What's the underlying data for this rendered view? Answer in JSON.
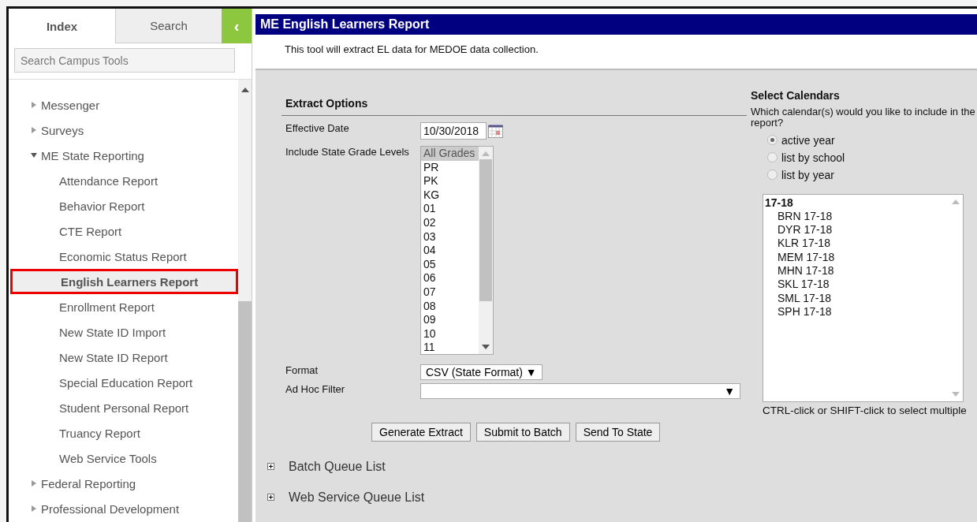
{
  "sidebar": {
    "tabs": [
      {
        "label": "Index",
        "selected": true
      },
      {
        "label": "Search",
        "selected": false
      }
    ],
    "collapse_button": "‹",
    "search": {
      "placeholder": "Search Campus Tools"
    },
    "tree": [
      {
        "label": "Messenger",
        "expanded": false
      },
      {
        "label": "Surveys",
        "expanded": false
      },
      {
        "label": "ME State Reporting",
        "expanded": true,
        "children": [
          {
            "label": "Attendance Report",
            "selected": false
          },
          {
            "label": "Behavior Report",
            "selected": false
          },
          {
            "label": "CTE Report",
            "selected": false
          },
          {
            "label": "Economic Status Report",
            "selected": false
          },
          {
            "label": "English Learners Report",
            "selected": true
          },
          {
            "label": "Enrollment Report",
            "selected": false
          },
          {
            "label": "New State ID Import",
            "selected": false
          },
          {
            "label": "New State ID Report",
            "selected": false
          },
          {
            "label": "Special Education Report",
            "selected": false
          },
          {
            "label": "Student Personal Report",
            "selected": false
          },
          {
            "label": "Truancy Report",
            "selected": false
          },
          {
            "label": "Web Service Tools",
            "selected": false
          }
        ]
      },
      {
        "label": "Federal Reporting",
        "expanded": false
      },
      {
        "label": "Professional Development",
        "expanded": false
      }
    ]
  },
  "tool": {
    "title": "ME English Learners Report",
    "description": "This tool will extract EL data for MEDOE data collection.",
    "extract_options": {
      "heading": "Extract Options",
      "effective_date": {
        "label": "Effective Date",
        "value": "10/30/2018"
      },
      "grade_levels": {
        "label": "Include State Grade Levels",
        "options": [
          {
            "label": "All Grades",
            "selected": true
          },
          {
            "label": "PR",
            "selected": false
          },
          {
            "label": "PK",
            "selected": false
          },
          {
            "label": "KG",
            "selected": false
          },
          {
            "label": "01",
            "selected": false
          },
          {
            "label": "02",
            "selected": false
          },
          {
            "label": "03",
            "selected": false
          },
          {
            "label": "04",
            "selected": false
          },
          {
            "label": "05",
            "selected": false
          },
          {
            "label": "06",
            "selected": false
          },
          {
            "label": "07",
            "selected": false
          },
          {
            "label": "08",
            "selected": false
          },
          {
            "label": "09",
            "selected": false
          },
          {
            "label": "10",
            "selected": false
          },
          {
            "label": "11",
            "selected": false
          }
        ]
      },
      "format": {
        "label": "Format",
        "value": "CSV (State Format) ▼"
      },
      "ad_hoc_filter": {
        "label": "Ad Hoc Filter",
        "arrow": "▼"
      }
    },
    "buttons": [
      "Generate Extract",
      "Submit to Batch",
      "Send To State"
    ],
    "sections": [
      {
        "label": "Batch Queue List",
        "expanded": false
      },
      {
        "label": "Web Service Queue List",
        "expanded": false
      }
    ],
    "calendars": {
      "heading": "Select Calendars",
      "question": "Which calendar(s) would you like to include in the report?",
      "modes": [
        {
          "label": "active year",
          "selected": true
        },
        {
          "label": "list by school",
          "selected": false
        },
        {
          "label": "list by year",
          "selected": false
        }
      ],
      "groups": [
        {
          "label": "17-18",
          "children": [
            {
              "label": "BRN 17-18",
              "selected": false
            },
            {
              "label": "DYR 17-18",
              "selected": false
            },
            {
              "label": "KLR 17-18",
              "selected": false
            },
            {
              "label": "MEM 17-18",
              "selected": false
            },
            {
              "label": "MHN 17-18",
              "selected": false
            },
            {
              "label": "SKL 17-18",
              "selected": false
            },
            {
              "label": "SML 17-18",
              "selected": false
            },
            {
              "label": "SPH 17-18",
              "selected": false
            }
          ]
        }
      ],
      "hint": "CTRL-click or SHIFT-click to select multiple"
    }
  }
}
